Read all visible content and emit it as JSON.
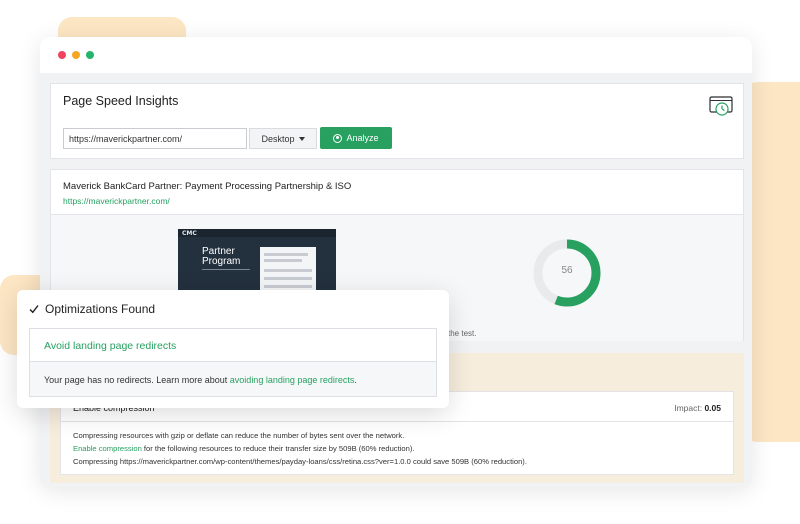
{
  "app": {
    "title": "Page Speed Insights"
  },
  "form": {
    "url_value": "https://maverickpartner.com/",
    "device_label": "Desktop",
    "analyze_label": "Analyze"
  },
  "result": {
    "site_title": "Maverick BankCard Partner: Payment Processing Partnership & ISO",
    "site_url": "https://maverickpartner.com/",
    "score": 56,
    "note_tail": "the test.",
    "thumbnail": {
      "logo": "CMC",
      "heading_line1": "Partner",
      "heading_line2": "Program"
    }
  },
  "rule": {
    "title": "Enable compression",
    "impact_label": "Impact:",
    "impact_value": "0.05",
    "line1": "Compressing resources with gzip or deflate can reduce the number of bytes sent over the network.",
    "line2_link": "Enable compression",
    "line2_rest": " for the following resources to reduce their transfer size by 509B (60% reduction).",
    "line3": "Compressing https://maverickpartner.com/wp-content/themes/payday-loans/css/retina.css?ver=1.0.0 could save 509B (60% reduction)."
  },
  "optimizations": {
    "header": "Optimizations Found",
    "item_title": "Avoid landing page redirects",
    "item_desc_prefix": "Your page has no redirects. Learn more about ",
    "item_desc_link": "avoiding landing page redirects",
    "item_desc_suffix": "."
  },
  "colors": {
    "accent": "#27a060",
    "gauge_track": "#e9eaec",
    "highlight_bg": "#fce6c4"
  }
}
